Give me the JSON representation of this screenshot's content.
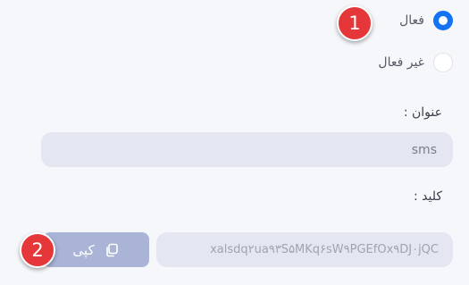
{
  "status": {
    "options": [
      {
        "label": "فعال",
        "selected": true
      },
      {
        "label": "غیر فعال",
        "selected": false
      }
    ]
  },
  "title_field": {
    "label": "عنوان :",
    "value": "sms"
  },
  "key_field": {
    "label": "کلید :",
    "value": "xalsdq۲ua۹۳S۵MKq۶sW۹PGEfOx۹DJ۰jQC",
    "copy_label": "کپی",
    "copy_icon": "copy-icon"
  },
  "badges": {
    "badge1": "1",
    "badge2": "2"
  },
  "colors": {
    "accent": "#1572f5",
    "badge": "#e5363a",
    "button": "#a9b4d6",
    "input_bg": "#e4e6f1"
  }
}
